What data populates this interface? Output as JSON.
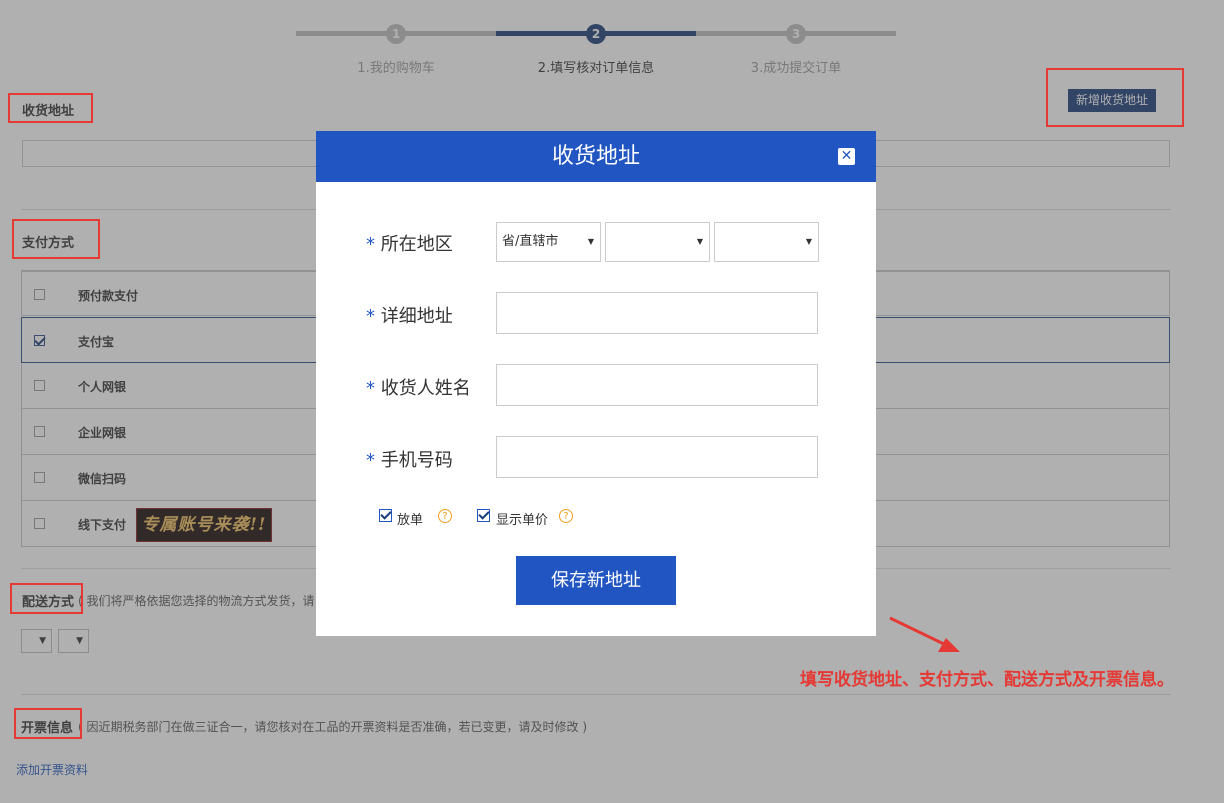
{
  "steps": [
    {
      "num": "1",
      "label": "1.我的购物车"
    },
    {
      "num": "2",
      "label": "2.填写核对订单信息"
    },
    {
      "num": "3",
      "label": "3.成功提交订单"
    }
  ],
  "address_section": {
    "title": "收货地址",
    "add_button": "新增收货地址"
  },
  "payment_section": {
    "title": "支付方式",
    "methods": [
      {
        "label": "预付款支付",
        "checked": false
      },
      {
        "label": "支付宝",
        "checked": true
      },
      {
        "label": "个人网银",
        "checked": false
      },
      {
        "label": "企业网银",
        "checked": false
      },
      {
        "label": "微信扫码",
        "checked": false
      },
      {
        "label": "线下支付",
        "checked": false
      }
    ],
    "promo_text": "专属账号来袭!!"
  },
  "shipping_section": {
    "title": "配送方式",
    "note": "( 我们将严格依据您选择的物流方式发货，请"
  },
  "invoice_section": {
    "title": "开票信息",
    "note": "( 因近期税务部门在做三证合一，请您核对在工品的开票资料是否准确，若已变更，请及时修改 )",
    "add_link": "添加开票资料"
  },
  "modal": {
    "title": "收货地址",
    "close": "✕",
    "fields": {
      "region_label": "所在地区",
      "province_placeholder": "省/直辖市",
      "address_label": "详细地址",
      "name_label": "收货人姓名",
      "phone_label": "手机号码"
    },
    "options": [
      {
        "label": "放单",
        "checked": true
      },
      {
        "label": "显示单价",
        "checked": true
      }
    ],
    "help_glyph": "?",
    "save_button": "保存新地址",
    "required_mark": "*"
  },
  "annotation": {
    "text": "填写收货地址、支付方式、配送方式及开票信息。",
    "color": "#e53935"
  },
  "colors": {
    "primary": "#2156c2",
    "dark_navy": "#1a3c7a",
    "highlight_red": "#e53935"
  }
}
